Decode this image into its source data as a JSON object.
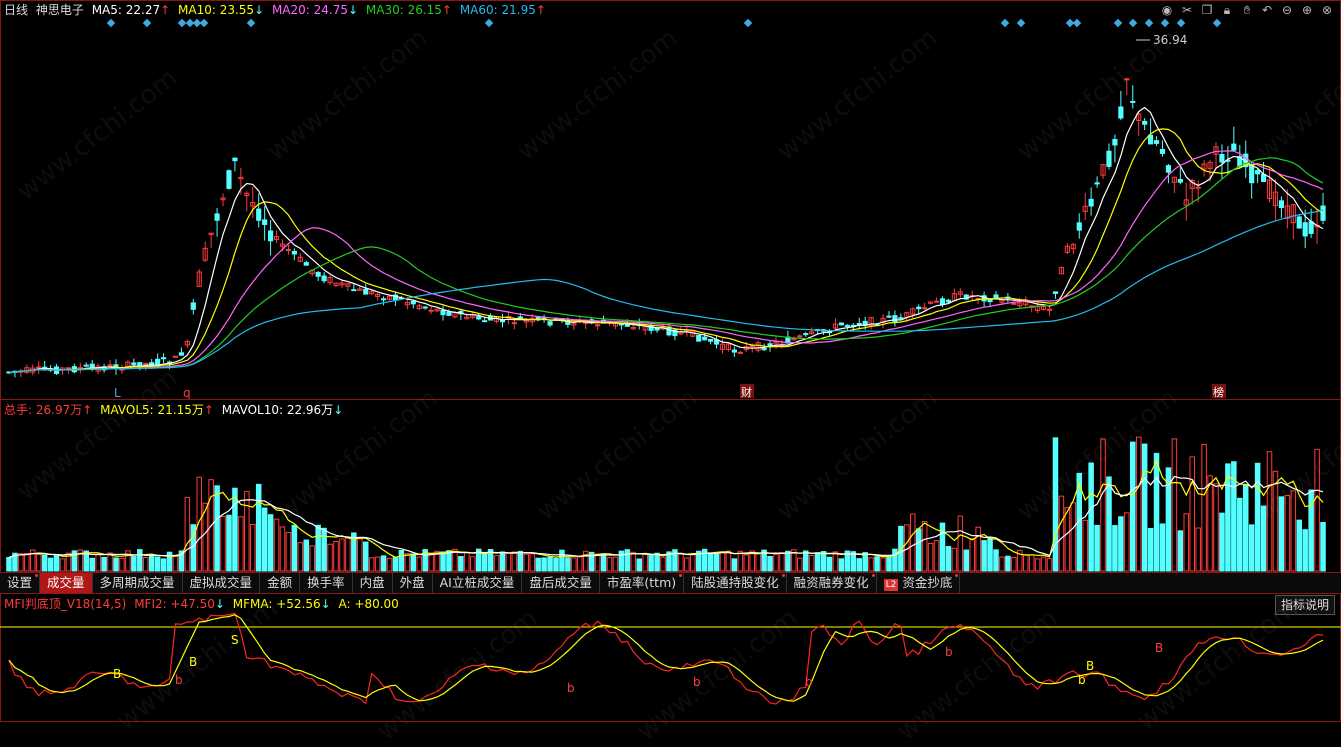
{
  "main_legend": {
    "title": "日线",
    "stock": "神思电子",
    "ma5": "MA5: 22.27",
    "ma10": "MA10: 23.55",
    "ma20": "MA20: 24.75",
    "ma30": "MA30: 26.15",
    "ma60": "MA60: 21.95",
    "ma5_arrow": "↑",
    "ma10_arrow": "↓",
    "ma20_arrow": "↓",
    "ma30_arrow": "↑",
    "ma60_arrow": "↑"
  },
  "main_annotations": {
    "high_label": "36.94",
    "marker_l": "L",
    "marker_q": "q",
    "marker_cai": "财",
    "marker_bang": "榜"
  },
  "volume_legend": {
    "total": "总手: 26.97万",
    "total_arrow": "↑",
    "mavol5": "MAVOL5: 21.15万",
    "mavol5_arrow": "↑",
    "mavol10": "MAVOL10: 22.96万",
    "mavol10_arrow": "↓"
  },
  "tabs": [
    {
      "label": "设置",
      "dot": true
    },
    {
      "label": "成交量",
      "active": true
    },
    {
      "label": "多周期成交量"
    },
    {
      "label": "虚拟成交量"
    },
    {
      "label": "金额"
    },
    {
      "label": "换手率"
    },
    {
      "label": "内盘"
    },
    {
      "label": "外盘"
    },
    {
      "label": "AI立桩成交量"
    },
    {
      "label": "盘后成交量"
    },
    {
      "label": "市盈率(ttm)",
      "dot": true
    },
    {
      "label": "陆股通持股变化",
      "dot": true
    },
    {
      "label": "融资融券变化",
      "dot": true
    },
    {
      "label": "资金抄底",
      "badge": "L2",
      "dot": true
    }
  ],
  "mfi_legend": {
    "name": "MFI判底顶_V18(14,5)",
    "mfi2": "MFI2: +47.50",
    "mfi2_arrow": "↓",
    "mfma": "MFMA: +52.56",
    "mfma_arrow": "↓",
    "a": "A: +80.00"
  },
  "hint_button": "指标说明",
  "toolbar_icons": [
    "eye-icon",
    "scissors-icon",
    "copy-icon",
    "lock-icon",
    "hand-icon",
    "undo-icon",
    "minus-icon",
    "plus-icon",
    "close-icon"
  ],
  "watermark": "www.cfchi.com",
  "colors": {
    "up": "#ff3b3b",
    "down": "#54ffff",
    "ma5": "#ffffff",
    "ma10": "#ffff00",
    "ma20": "#ff66ff",
    "ma30": "#22cc22",
    "ma60": "#22bbee",
    "grid": "#8b1414"
  },
  "mfi_signals": [
    "B",
    "b",
    "B",
    "S",
    "b",
    "b",
    "b",
    "b",
    "b",
    "B",
    "B",
    "b"
  ]
}
